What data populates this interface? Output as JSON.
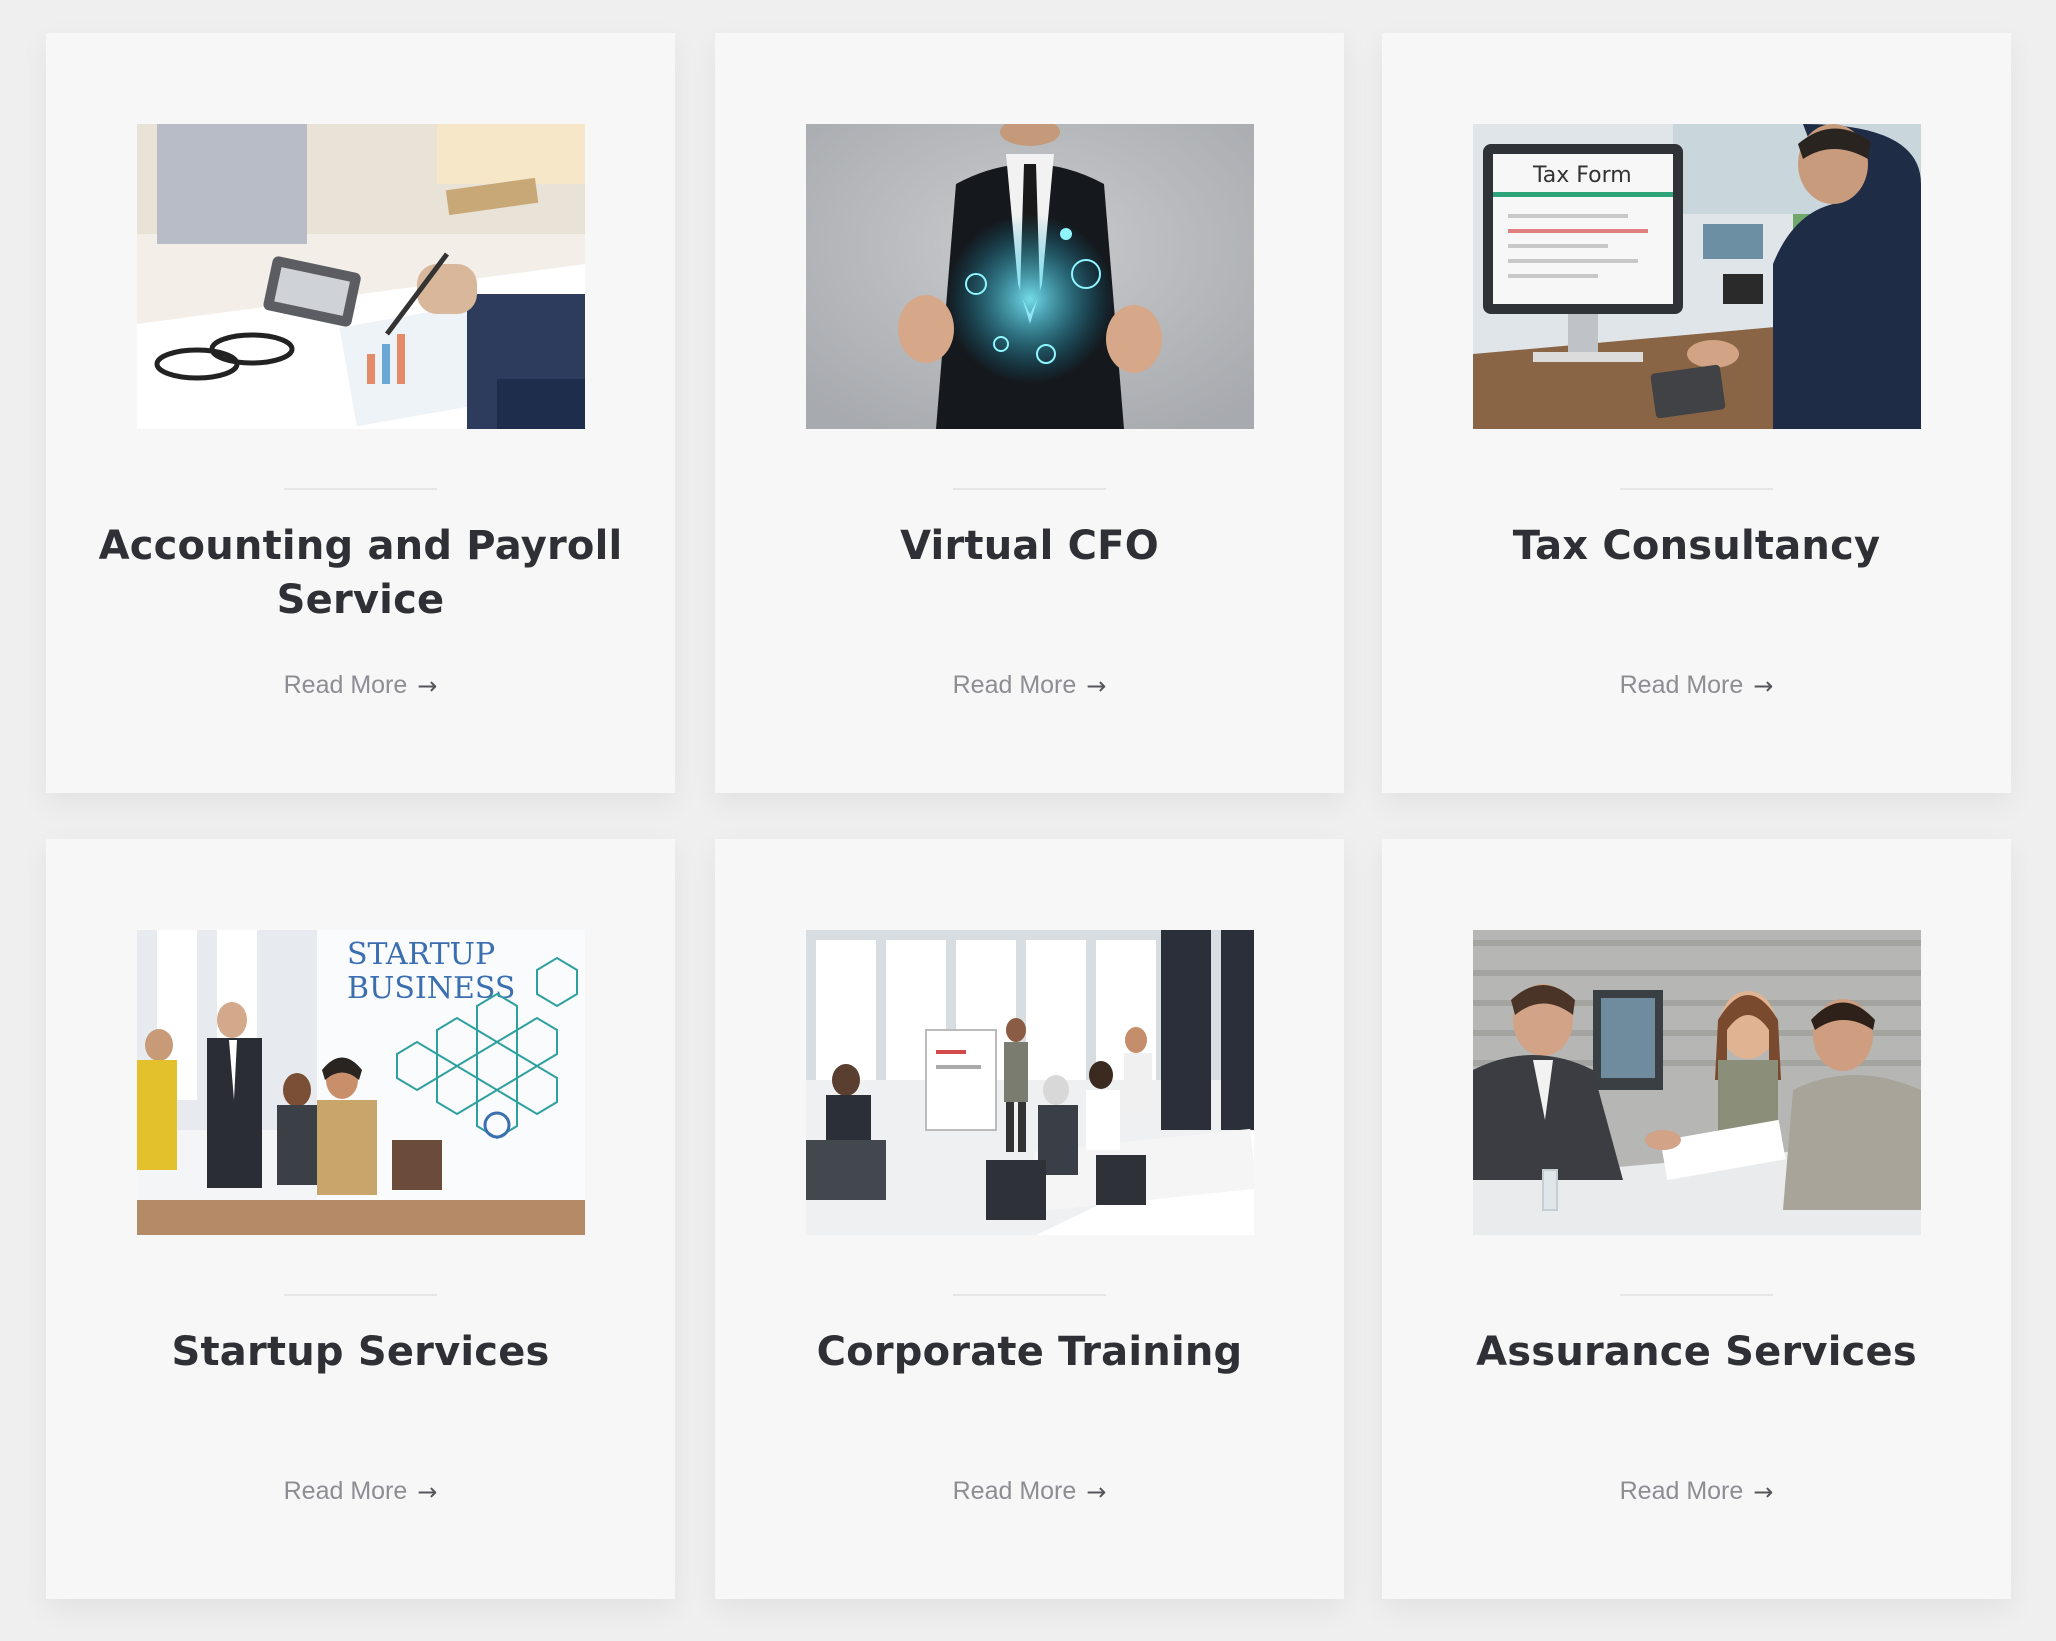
{
  "services": [
    {
      "title": "Accounting and Payroll Service",
      "link_label": "Read More",
      "arrow_icon": "arrow-right-icon",
      "image": "accounting-photo"
    },
    {
      "title": "Virtual CFO",
      "link_label": "Read More",
      "arrow_icon": "arrow-right-icon",
      "image": "virtual-cfo-photo"
    },
    {
      "title": "Tax Consultancy",
      "link_label": "Read More",
      "arrow_icon": "arrow-right-icon",
      "image": "tax-form-photo"
    },
    {
      "title": "Startup Services",
      "link_label": "Read More",
      "arrow_icon": "arrow-right-icon",
      "image": "startup-business-photo"
    },
    {
      "title": "Corporate Training",
      "link_label": "Read More",
      "arrow_icon": "arrow-right-icon",
      "image": "corporate-training-photo"
    },
    {
      "title": "Assurance Services",
      "link_label": "Read More",
      "arrow_icon": "arrow-right-icon",
      "image": "assurance-meeting-photo"
    }
  ],
  "image_text": {
    "tax_form": "Tax Form",
    "startup_line1": "STARTUP",
    "startup_line2": "BUSINESS"
  },
  "colors": {
    "page_background": "#efefef",
    "card_background": "#f7f7f7",
    "title_text": "#2f2f36",
    "link_text": "#8d8d93"
  }
}
